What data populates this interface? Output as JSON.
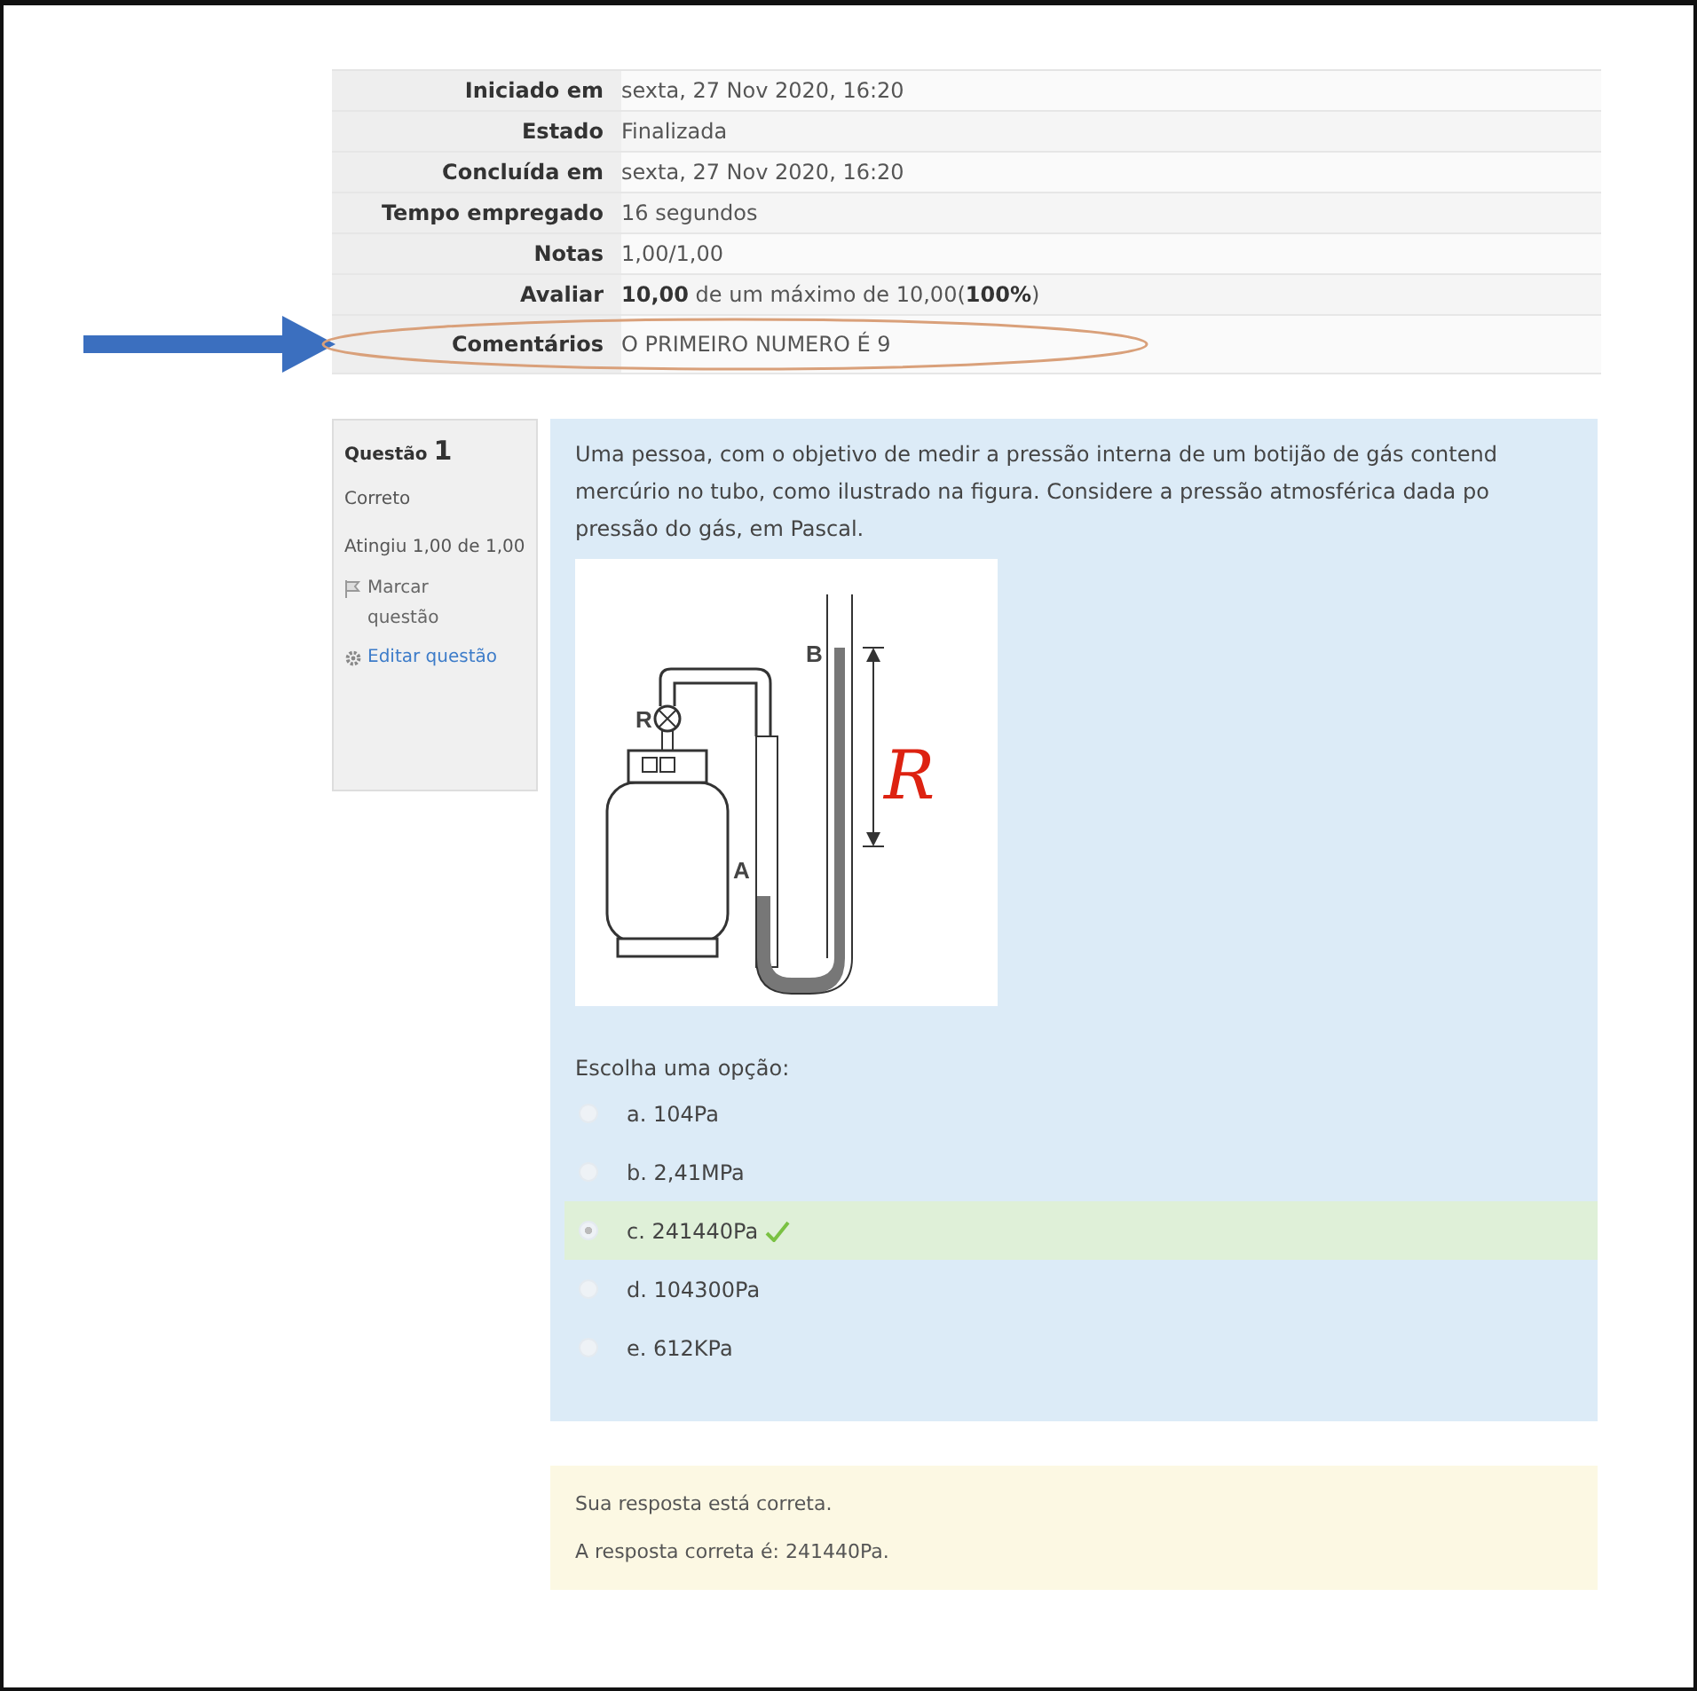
{
  "summary": [
    {
      "label": "Iniciado em",
      "value": "sexta, 27 Nov 2020, 16:20"
    },
    {
      "label": "Estado",
      "value": "Finalizada"
    },
    {
      "label": "Concluída em",
      "value": "sexta, 27 Nov 2020, 16:20"
    },
    {
      "label": "Tempo empregado",
      "value": "16 segundos"
    },
    {
      "label": "Notas",
      "value": "1,00/1,00"
    },
    {
      "label": "Avaliar",
      "value": "**10,00** de um máximo de 10,00(**100%**)"
    },
    {
      "label": "Comentários",
      "value": "O PRIMEIRO NUMERO É 9",
      "circled": true
    }
  ],
  "question_info": {
    "label": "Questão",
    "number": "1",
    "status": "Correto",
    "grade": "Atingiu 1,00 de 1,00",
    "flag_link": "Marcar questão",
    "edit_link": "Editar questão"
  },
  "question": {
    "lines": [
      "Uma pessoa, com o objetivo de medir a pressão interna de um botijão de gás contend",
      "mercúrio no tubo, como ilustrado na figura. Considere a pressão atmosférica dada po",
      "pressão do gás, em Pascal."
    ],
    "figure": {
      "valve_label": "R",
      "left_label": "A",
      "right_label": "B",
      "handwritten_note": "R"
    },
    "prompt": "Escolha uma opção:",
    "options": [
      {
        "text": "a. 104Pa",
        "selected": false,
        "correct": false
      },
      {
        "text": "b. 2,41MPa",
        "selected": false,
        "correct": false
      },
      {
        "text": "c. 241440Pa",
        "selected": true,
        "correct": true
      },
      {
        "text": "d. 104300Pa",
        "selected": false,
        "correct": false
      },
      {
        "text": "e. 612KPa",
        "selected": false,
        "correct": false
      }
    ]
  },
  "feedback": [
    "Sua resposta está correta.",
    "A resposta correta é: 241440Pa."
  ]
}
